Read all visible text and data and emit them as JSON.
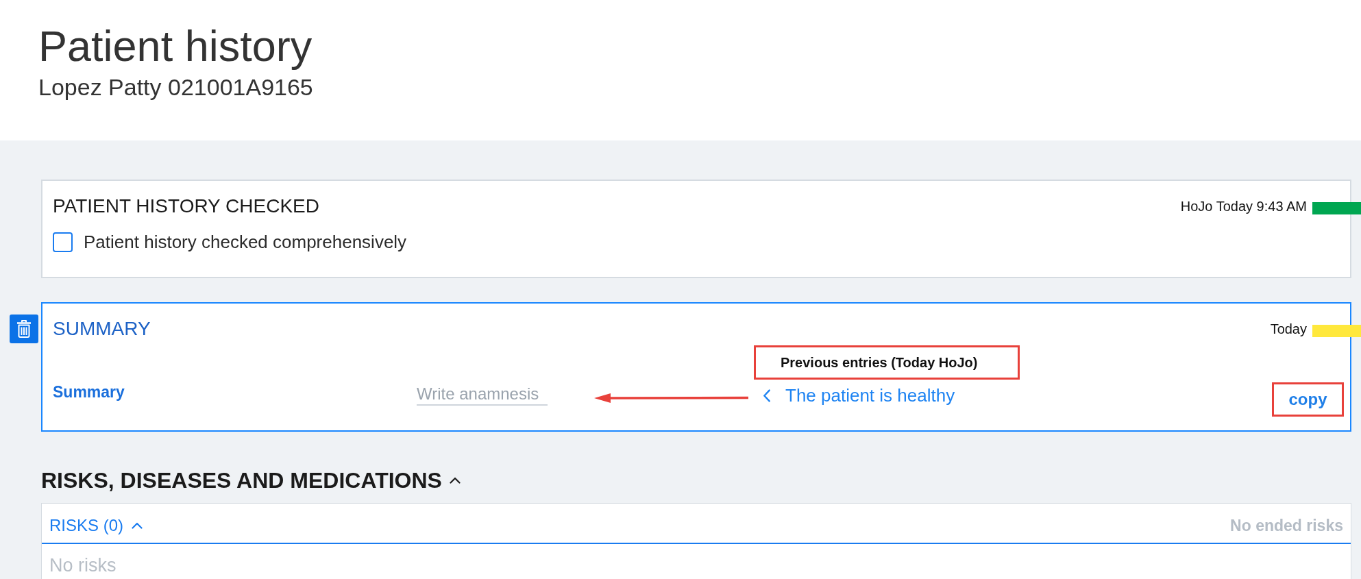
{
  "header": {
    "title": "Patient history",
    "subtitle": "Lopez Patty 021001A9165"
  },
  "cards": [
    {
      "kind": "checkbox",
      "title": "PATIENT HISTORY CHECKED",
      "meta": "HoJo Today 9:43 AM",
      "color": "#00a651",
      "selected": false,
      "checkbox": {
        "label": "Patient history checked comprehensively",
        "checked": false
      }
    },
    {
      "kind": "text_entry",
      "title": "SUMMARY",
      "meta": "Today",
      "color": "#ffe83c",
      "selected": true,
      "field_label": "Summary",
      "input": {
        "placeholder": "Write anamnesis"
      },
      "previous_entries": {
        "heading": "Previous entries (Today HoJo)",
        "highlighted": true,
        "entry": "The patient is healthy"
      },
      "copy_button": {
        "label": "copy",
        "highlighted": true
      }
    }
  ],
  "risks_section": {
    "title": "RISKS, DISEASES AND MEDICATIONS",
    "expanded": true,
    "risks_panel": {
      "title": "RISKS (0)",
      "expanded": true,
      "ended_note": "No ended risks",
      "empty_text": "No risks"
    }
  }
}
